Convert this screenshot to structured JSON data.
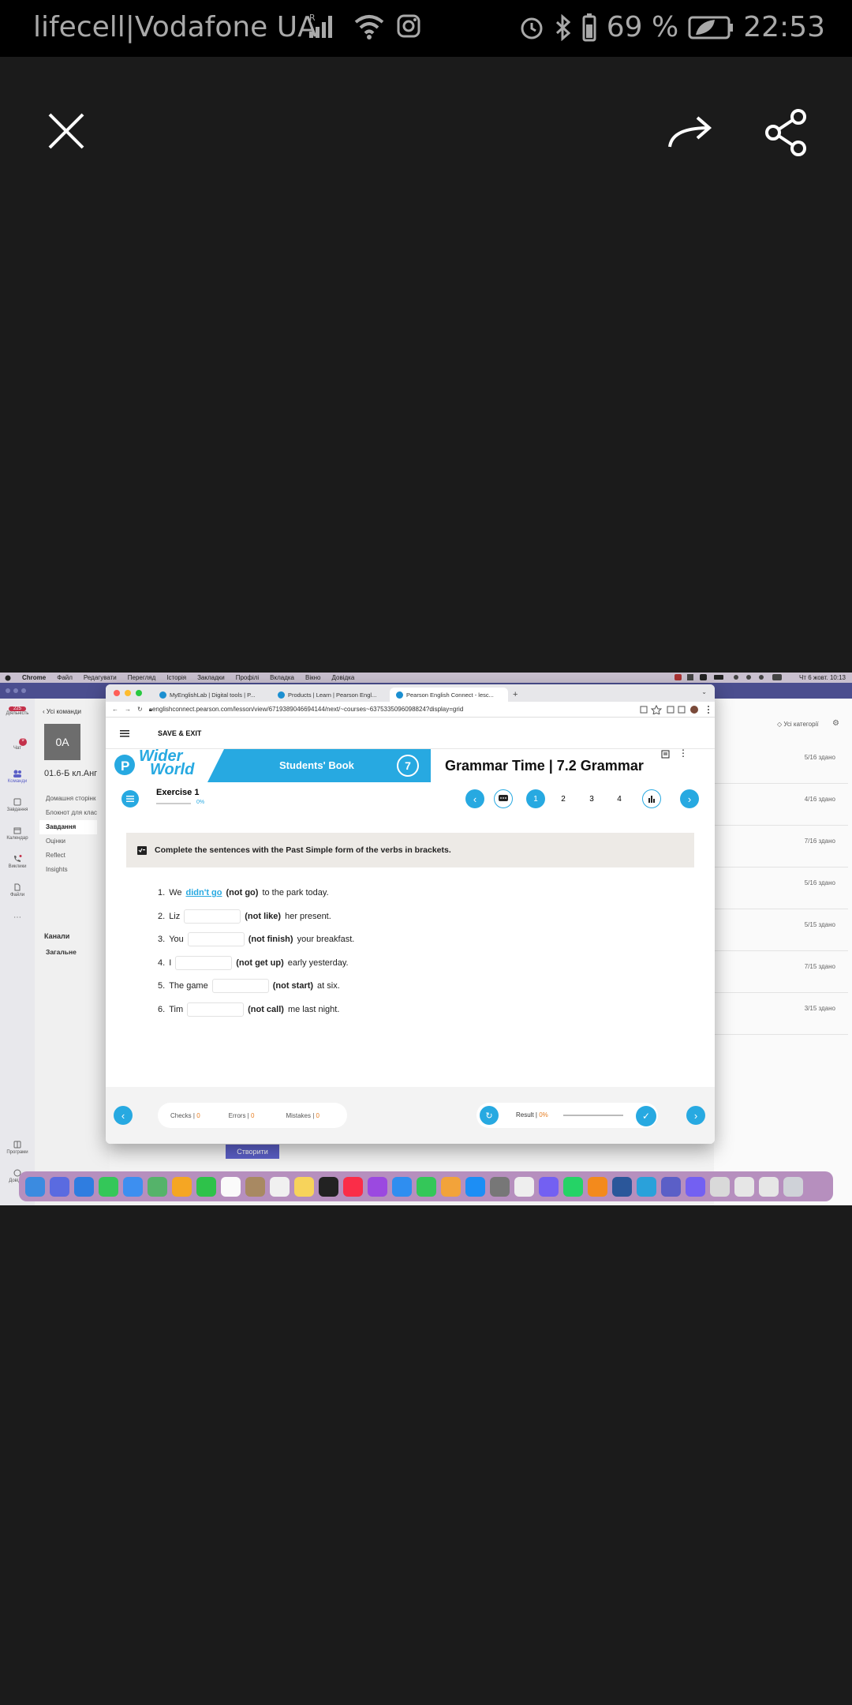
{
  "status_bar": {
    "carrier": "lifecell|Vodafone UA",
    "battery": "69 %",
    "time": "22:53",
    "signal_label": "R"
  },
  "screenshot": {
    "mac_menu": {
      "app": "Chrome",
      "items": [
        "Файл",
        "Редагувати",
        "Перегляд",
        "Історія",
        "Закладки",
        "Профілі",
        "Вкладка",
        "Вікно",
        "Довідка"
      ],
      "clock": "Чт 6 жовт. 10:13"
    },
    "teams": {
      "back_label": "Усі команди",
      "team_avatar": "0A",
      "team_name": "01.6-Б кл.Анг",
      "menu": [
        "Домашня сторінк",
        "Блокнот для клас",
        "Завдання",
        "Оцінки",
        "Reflect",
        "Insights"
      ],
      "channels_label": "Канали",
      "channel": "Загальне",
      "rail": [
        "Діяльність",
        "Чат",
        "Команди",
        "Завдання",
        "Календар",
        "Виклики",
        "Файли",
        "Програми",
        "Довідка"
      ],
      "rail_badge_activity": "225",
      "rail_badge_chat": "9",
      "categories_label": "Усі категорії",
      "submitted": [
        "5/16 здано",
        "4/16 здано",
        "7/16 здано",
        "5/16 здано",
        "5/15 здано",
        "7/15 здано",
        "3/15 здано"
      ],
      "create_button": "Створити"
    },
    "browser": {
      "tabs": [
        "MyEnglishLab | Digital tools | P...",
        "Products | Learn | Pearson Engl...",
        "Pearson English Connect - lesc..."
      ],
      "url": "englishconnect.pearson.com/lesson/view/6719389046694144/next/~courses~6375335096098824?display=grid",
      "save_exit": "SAVE & EXIT",
      "book_logo_line1": "Wider",
      "book_logo_line2": "World",
      "book_label": "Students' Book",
      "book_level": "7",
      "lesson_title": "Grammar Time | 7.2 Grammar",
      "exercise_title": "Exercise 1",
      "exercise_progress": "0%",
      "pages": [
        "1",
        "2",
        "3",
        "4"
      ],
      "active_page": "1",
      "instruction": "Complete the sentences with the Past Simple form of the verbs in brackets.",
      "sentences": [
        {
          "num": "1.",
          "pre": "We",
          "answer": "didn't go",
          "hint": "(not go)",
          "post": "to the park today."
        },
        {
          "num": "2.",
          "pre": "Liz",
          "hint": "(not like)",
          "post": "her present."
        },
        {
          "num": "3.",
          "pre": "You",
          "hint": "(not finish)",
          "post": "your breakfast."
        },
        {
          "num": "4.",
          "pre": "I",
          "hint": "(not get up)",
          "post": "early yesterday."
        },
        {
          "num": "5.",
          "pre": "The game",
          "hint": "(not start)",
          "post": "at six."
        },
        {
          "num": "6.",
          "pre": "Tim",
          "hint": "(not call)",
          "post": "me last night."
        }
      ],
      "checks_label": "Checks |",
      "checks_value": "0",
      "errors_label": "Errors |",
      "errors_value": "0",
      "mistakes_label": "Mistakes |",
      "mistakes_value": "0",
      "result_label": "Result |",
      "result_value": "0%",
      "accent": "#27a9e1"
    }
  }
}
